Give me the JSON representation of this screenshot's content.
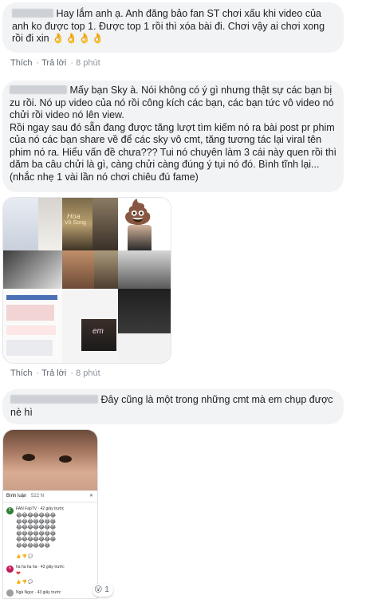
{
  "comments": [
    {
      "text": "Hay lắm anh ạ. Anh đăng bảo fan ST chơi xấu khi video của anh ko được top 1. Được top 1 rồi thì xóa bài đi. Chơi vậy ai chơi xong rồi đi xin",
      "emojis": "👌👌👌👌",
      "actions": {
        "like": "Thích",
        "reply": "Trả lời",
        "time": "8 phút"
      }
    },
    {
      "text_prefix": "Mấy bạn Sky à. Nói không có ý gì nhưng thật sự các bạn bị zu rồi. Nó up video của nó rồi công kích các bạn, các bạn tức vô video nó chửi rồi video nó lên view.",
      "text_body": "Rồi ngay sau đó sẵn đang được tăng lượt tìm kiếm nó ra bài post pr phim của nó các bạn share về để các sky vô cmt, tăng tương tác lại viral tên phim nó ra. Hiểu vấn đề chưa??? Tui nó chuyên làm 3 cái này quen rồi thì dăm ba câu chửi là gì, càng chửi càng đúng ý tụi nó đó. Bình tĩnh lại...(nhắc nhẹ 1 vài lần nó chơi chiêu đú fame)",
      "actions": {
        "like": "Thích",
        "reply": "Trả lời",
        "time": "8 phút"
      }
    },
    {
      "text": "Đây cũng là một trong những cmt mà em chụp được nè hì",
      "reaction": {
        "emoji": "😮",
        "count": "1"
      }
    }
  ],
  "collage": {
    "caption_hoa": "Hoa",
    "caption_vo_song": "Vô Song",
    "caption_em": "em"
  },
  "phone": {
    "title": "Bình luận",
    "count": "522 N",
    "c1_name": "FAN FapTV",
    "c1_meta": "42 giây trước",
    "c2_name": "ha ha ha ha",
    "c2_meta": "43 giây trước",
    "c3_name": "Ngà Ngọc",
    "c3_meta": "43 giây trước",
    "emoji_rows": [
      "😂😂😂😂😂😂😂",
      "😂😂😂😂😂😂😂",
      "😂😂😂😂😂😂😂",
      "😂😂😂😂😂😂😂",
      "😂😂😂😂😂😂😂",
      "😂😂😂😂😂😂"
    ]
  },
  "colors": {
    "bubble": "#f2f3f5",
    "action_text": "#606770",
    "fb_link": "#385898"
  }
}
